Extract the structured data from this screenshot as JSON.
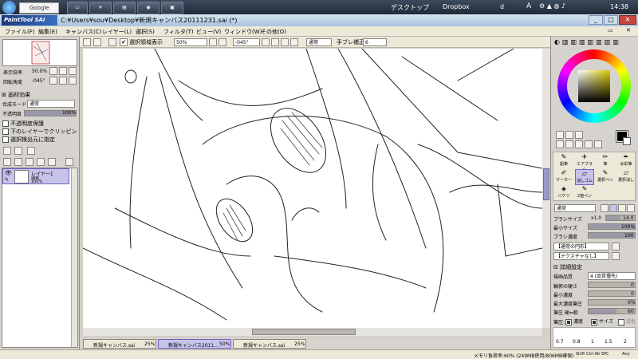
{
  "taskbar": {
    "google": "Google",
    "desktop": "デスクトップ",
    "dropbox": "Dropbox",
    "d": "d",
    "clock": "14:38"
  },
  "window": {
    "title": "C:¥Users¥sou¥Desktop¥新規キャンバス20111231.sai (*)",
    "logo": "PaintTool SAI"
  },
  "menu": [
    "ファイル(F)",
    "編集(E)",
    "キャンバス(C)",
    "レイヤー(L)",
    "選択(S)",
    "フィルタ(T)",
    "ビュー(V)",
    "ウィンドウ(W)",
    "その他(O)"
  ],
  "toolbar": {
    "selection_label": "選択領域表示",
    "zoom": "50%",
    "angle": "-045°",
    "blend": "通常",
    "stabilizer_label": "手ブレ補正",
    "stabilizer": "6"
  },
  "navigator": {
    "zoom_label": "表示倍率",
    "zoom_value": "50.0%",
    "angle_label": "回転角度",
    "angle_value": "-045°"
  },
  "layer_panel": {
    "effect_label": "画材効果",
    "blend_label": "合成モード",
    "blend_value": "通常",
    "opacity_label": "不透明度",
    "opacity_value": "100%",
    "protect_label": "不透明度保護",
    "clip_label": "下のレイヤーでクリッピング",
    "select_label": "選択検出元に指定",
    "layer_name": "レイヤー1",
    "layer_mode": "通常",
    "layer_opacity": "100%"
  },
  "tools": [
    "鉛筆",
    "エアブラシ",
    "筆",
    "水彩筆",
    "マーカー",
    "消しゴム",
    "選択ペン",
    "選択消し",
    "バケツ",
    "2値ペン"
  ],
  "brush": {
    "mode": "通常",
    "size_label": "ブラシサイズ",
    "size_mult": "x1.0",
    "size_value": "14.0",
    "min_size_label": "最小サイズ",
    "min_size_value": "100%",
    "density_label": "ブラシ濃度",
    "density_value": "100",
    "shape_label": "【通常の円形】",
    "texture_label": "【テクスチャなし】",
    "detail_label": "詳細設定",
    "quality_label": "描画品質",
    "quality_value": "4 (品質優先)",
    "edge_label": "輪郭の硬さ",
    "edge_value": "0",
    "min_density_label": "最小濃度",
    "min_density_value": "0",
    "max_pressure_label": "最大濃度筆圧",
    "max_pressure_value": "0%",
    "hardness_label": "筆圧 硬⇔軟",
    "hardness_value": "60",
    "pressure_label": "筆圧:",
    "density_check": "濃度",
    "size_check": "サイズ",
    "blend_check": "混色",
    "presets": [
      "0.7",
      "0.8",
      "1",
      "1.5",
      "2"
    ]
  },
  "tabs": [
    {
      "name": "新規キャンバス.sai",
      "zoom": "25%"
    },
    {
      "name": "新規キャンバス2011...",
      "zoom": "50%"
    },
    {
      "name": "新規キャンバス.sai",
      "zoom": "25%"
    }
  ],
  "status": {
    "memory": "メモリ負荷率:60% (249MB使用/806MB確保)",
    "keys": "Shift Ctrl Alt SPC",
    "any": "Any"
  }
}
